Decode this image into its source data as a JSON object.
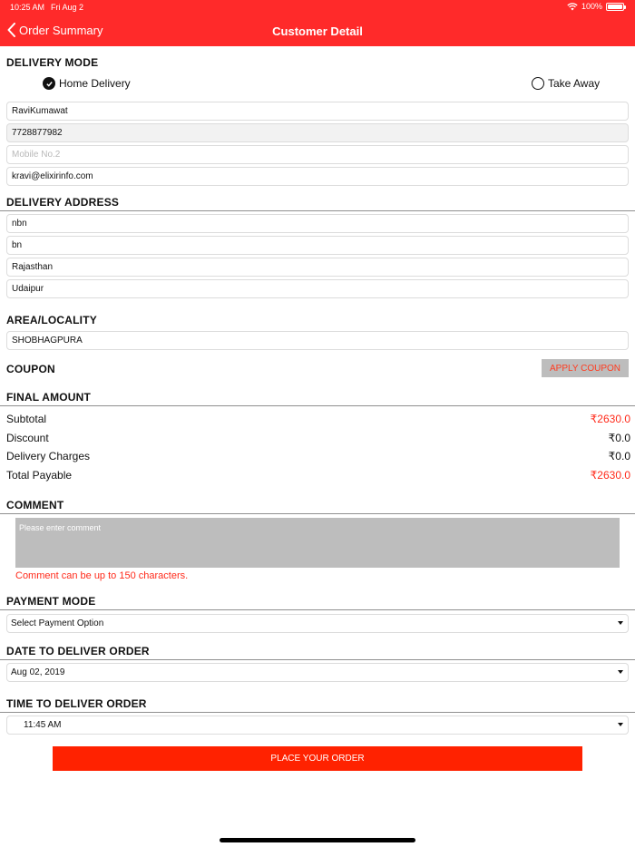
{
  "status": {
    "time": "10:25 AM",
    "date": "Fri Aug 2",
    "battery": "100%"
  },
  "nav": {
    "back_label": "Order Summary",
    "title": "Customer Detail"
  },
  "delivery_mode": {
    "title": "DELIVERY MODE",
    "options": [
      {
        "label": "Home Delivery",
        "selected": true
      },
      {
        "label": "Take Away",
        "selected": false
      }
    ]
  },
  "customer": {
    "name": "RaviKumawat",
    "mobile1": "7728877982",
    "mobile2_placeholder": "Mobile No.2",
    "email": "kravi@elixirinfo.com"
  },
  "address": {
    "title": "DELIVERY ADDRESS",
    "line1": "nbn",
    "line2": "bn",
    "state": "Rajasthan",
    "city": "Udaipur"
  },
  "area": {
    "title": "AREA/LOCALITY",
    "value": "SHOBHAGPURA"
  },
  "coupon": {
    "title": "COUPON",
    "button": "APPLY COUPON"
  },
  "final_amount": {
    "title": "FINAL AMOUNT",
    "rows": [
      {
        "label": "Subtotal",
        "value": "₹2630.0",
        "highlight": true
      },
      {
        "label": "Discount",
        "value": "₹0.0",
        "highlight": false
      },
      {
        "label": "Delivery Charges",
        "value": "₹0.0",
        "highlight": false
      },
      {
        "label": "Total Payable",
        "value": "₹2630.0",
        "highlight": true
      }
    ]
  },
  "comment": {
    "title": "COMMENT",
    "placeholder": "Please enter comment",
    "hint": "Comment can be up to 150 characters."
  },
  "payment": {
    "title": "PAYMENT MODE",
    "selected": "Select Payment Option"
  },
  "delivery_date": {
    "title": "DATE TO DELIVER ORDER",
    "selected": "Aug 02, 2019"
  },
  "delivery_time": {
    "title": "TIME TO DELIVER ORDER",
    "selected": "11:45 AM"
  },
  "place_order": "PLACE YOUR ORDER",
  "colors": {
    "accent": "#ff2a2a",
    "button": "#ff2200",
    "muted": "#bdbdbd"
  }
}
